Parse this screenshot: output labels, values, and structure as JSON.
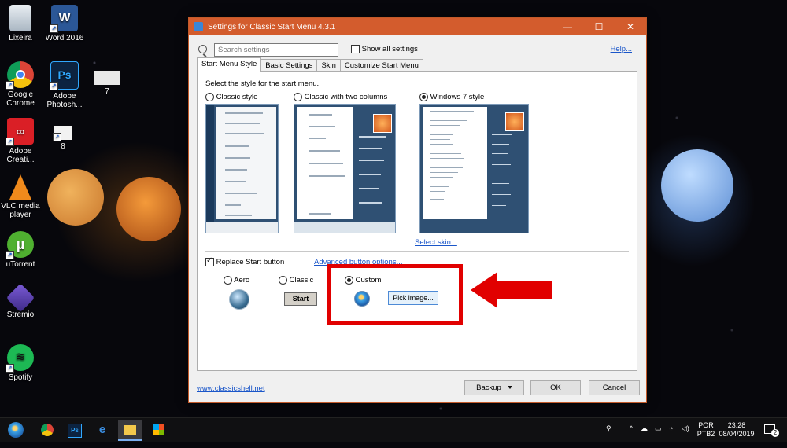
{
  "desktop": {
    "icons": [
      {
        "label": "Lixeira",
        "icon": "recycle-bin-icon"
      },
      {
        "label": "Word 2016",
        "icon": "word-icon"
      },
      {
        "label": "Google Chrome",
        "icon": "chrome-icon"
      },
      {
        "label": "Adobe Photosh...",
        "icon": "photoshop-icon"
      },
      {
        "label": "7",
        "icon": "file-7-icon"
      },
      {
        "label": "Adobe Creati...",
        "icon": "creative-cloud-icon"
      },
      {
        "label": "8",
        "icon": "file-8-icon"
      },
      {
        "label": "VLC media player",
        "icon": "vlc-icon"
      },
      {
        "label": "uTorrent",
        "icon": "utorrent-icon"
      },
      {
        "label": "Stremio",
        "icon": "stremio-icon"
      },
      {
        "label": "Spotify",
        "icon": "spotify-icon"
      }
    ]
  },
  "window": {
    "title": "Settings for Classic Start Menu 4.3.1",
    "search_placeholder": "Search settings",
    "show_all_label": "Show all settings",
    "help_label": "Help...",
    "tabs": [
      {
        "label": "Start Menu Style",
        "active": true
      },
      {
        "label": "Basic Settings",
        "active": false
      },
      {
        "label": "Skin",
        "active": false
      },
      {
        "label": "Customize Start Menu",
        "active": false
      }
    ],
    "section_label": "Select the style for the start menu.",
    "styles": [
      {
        "label": "Classic style",
        "selected": false
      },
      {
        "label": "Classic with two columns",
        "selected": false
      },
      {
        "label": "Windows 7 style",
        "selected": true
      }
    ],
    "select_skin_label": "Select skin...",
    "replace_start_label": "Replace Start button",
    "replace_start_checked": true,
    "advanced_button_label": "Advanced button options...",
    "button_options": [
      {
        "label": "Aero",
        "selected": false
      },
      {
        "label": "Classic",
        "selected": false
      },
      {
        "label": "Custom",
        "selected": true
      }
    ],
    "classic_start_label": "Start",
    "pick_image_label": "Pick image...",
    "website_label": "www.classicshell.net",
    "backup_label": "Backup",
    "ok_label": "OK",
    "cancel_label": "Cancel"
  },
  "taskbar": {
    "language_top": "POR",
    "language_bottom": "PTB2",
    "time": "23:28",
    "date": "08/04/2019",
    "notification_count": "2"
  },
  "colors": {
    "titlebar": "#d35c2d",
    "highlight": "#e10000",
    "link": "#1a56c9"
  }
}
